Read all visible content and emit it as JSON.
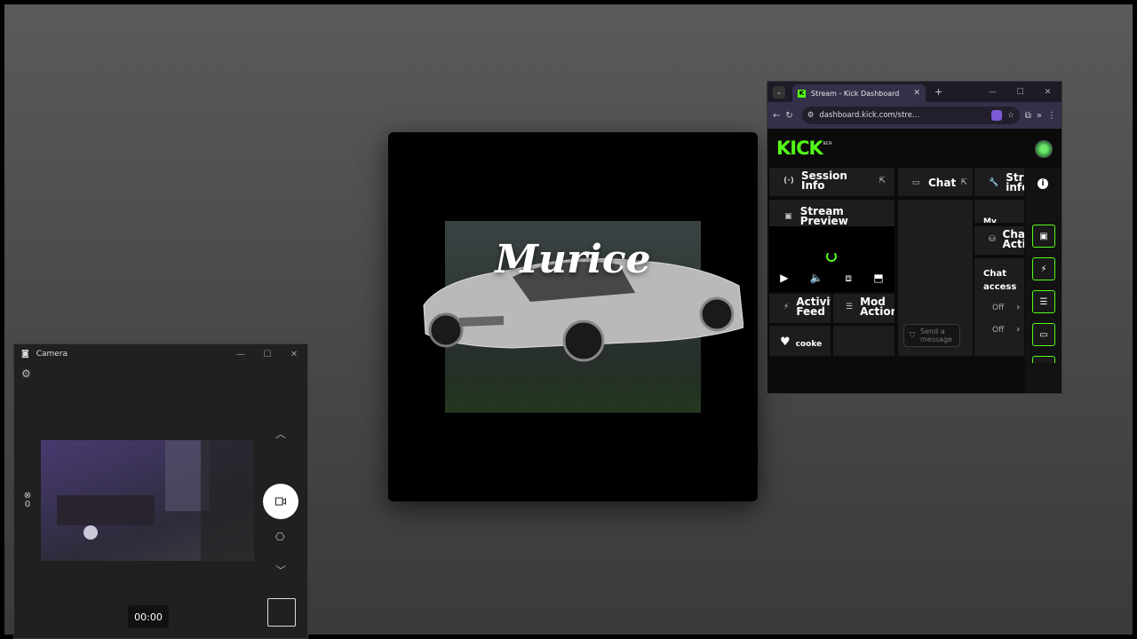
{
  "media": {
    "title": "Murice"
  },
  "camera": {
    "title": "Camera",
    "timer": "00:00",
    "left_badge": "0"
  },
  "browser": {
    "tab_title": "Stream - Kick Dashboard",
    "url": "dashboard.kick.com/stre..."
  },
  "kick": {
    "logo": "KICK",
    "beta": "BETA",
    "panels": {
      "session_info": "Session Info",
      "stream_preview": "Stream Preview",
      "chat": "Chat",
      "stream_info": "Stream info",
      "my_label": "My",
      "chat_actions": "Chat Actions",
      "chat_access": "Chat access",
      "off_1": "Off",
      "off_2": "Off",
      "activity_feed": "Activity Feed",
      "mod_actions": "Mod Actions",
      "cooke": "cooke",
      "send_message_placeholder": "Send a message"
    }
  },
  "colors": {
    "kick_green": "#53fc18",
    "browser_chrome": "#35304a"
  }
}
